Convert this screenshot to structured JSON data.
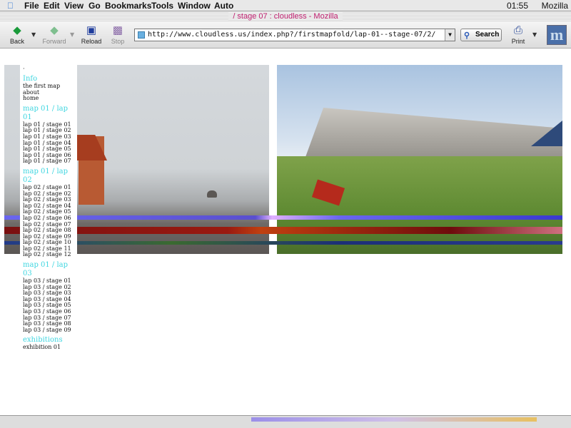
{
  "menubar": {
    "items": [
      "File",
      "Edit",
      "View",
      "Go",
      "Bookmarks",
      "Tools",
      "Window",
      "Auto"
    ],
    "clock": "01:55",
    "app": "Mozilla"
  },
  "window": {
    "title": "/ stage 07 : cloudless - Mozilla"
  },
  "toolbar": {
    "back_label": "Back",
    "forward_label": "Forward",
    "reload_label": "Reload",
    "stop_label": "Stop",
    "url": "http://www.cloudless.us/index.php?/firstmapfold/lap-01--stage-07/2/",
    "search_label": "Search",
    "print_label": "Print",
    "throbber_letter": "m"
  },
  "sidebar": {
    "top_mark": "·",
    "sections": [
      {
        "heading": "Info",
        "links": [
          "the first map",
          "about",
          "home"
        ]
      },
      {
        "heading": "map 01 / lap 01",
        "links": [
          "lap 01 / stage 01",
          "lap 01 / stage 02",
          "lap 01 / stage 03",
          "lap 01 / stage 04",
          "lap 01 / stage 05",
          "lap 01 / stage 06",
          "lap 01 / stage 07"
        ]
      },
      {
        "heading": "map 01 / lap 02",
        "links": [
          "lap 02 / stage 01",
          "lap 02 / stage 02",
          "lap 02 / stage 03",
          "lap 02 / stage 04",
          "lap 02 / stage 05",
          "lap 02 / stage 06",
          "lap 02 / stage 07",
          "lap 02 / stage 08",
          "lap 02 / stage 09",
          "lap 02 / stage 10",
          "lap 02 / stage 11",
          "lap 02 / stage 12"
        ]
      },
      {
        "heading": "map 01 / lap 03",
        "links": [
          "lap 03 / stage 01",
          "lap 03 / stage 02",
          "lap 03 / stage 03",
          "lap 03 / stage 04",
          "lap 03 / stage 05",
          "lap 03 / stage 06",
          "lap 03 / stage 07",
          "lap 03 / stage 08",
          "lap 03 / stage 09"
        ]
      },
      {
        "heading": "exhibitions",
        "links": [
          "exhibition 01"
        ]
      }
    ]
  },
  "colors": {
    "heading": "#3fd6e0",
    "title_text": "#c02070"
  },
  "icons": {
    "back": "back-arrow-icon",
    "forward": "forward-arrow-icon",
    "reload": "reload-icon",
    "stop": "stop-icon",
    "search": "search-icon",
    "print": "printer-icon"
  }
}
